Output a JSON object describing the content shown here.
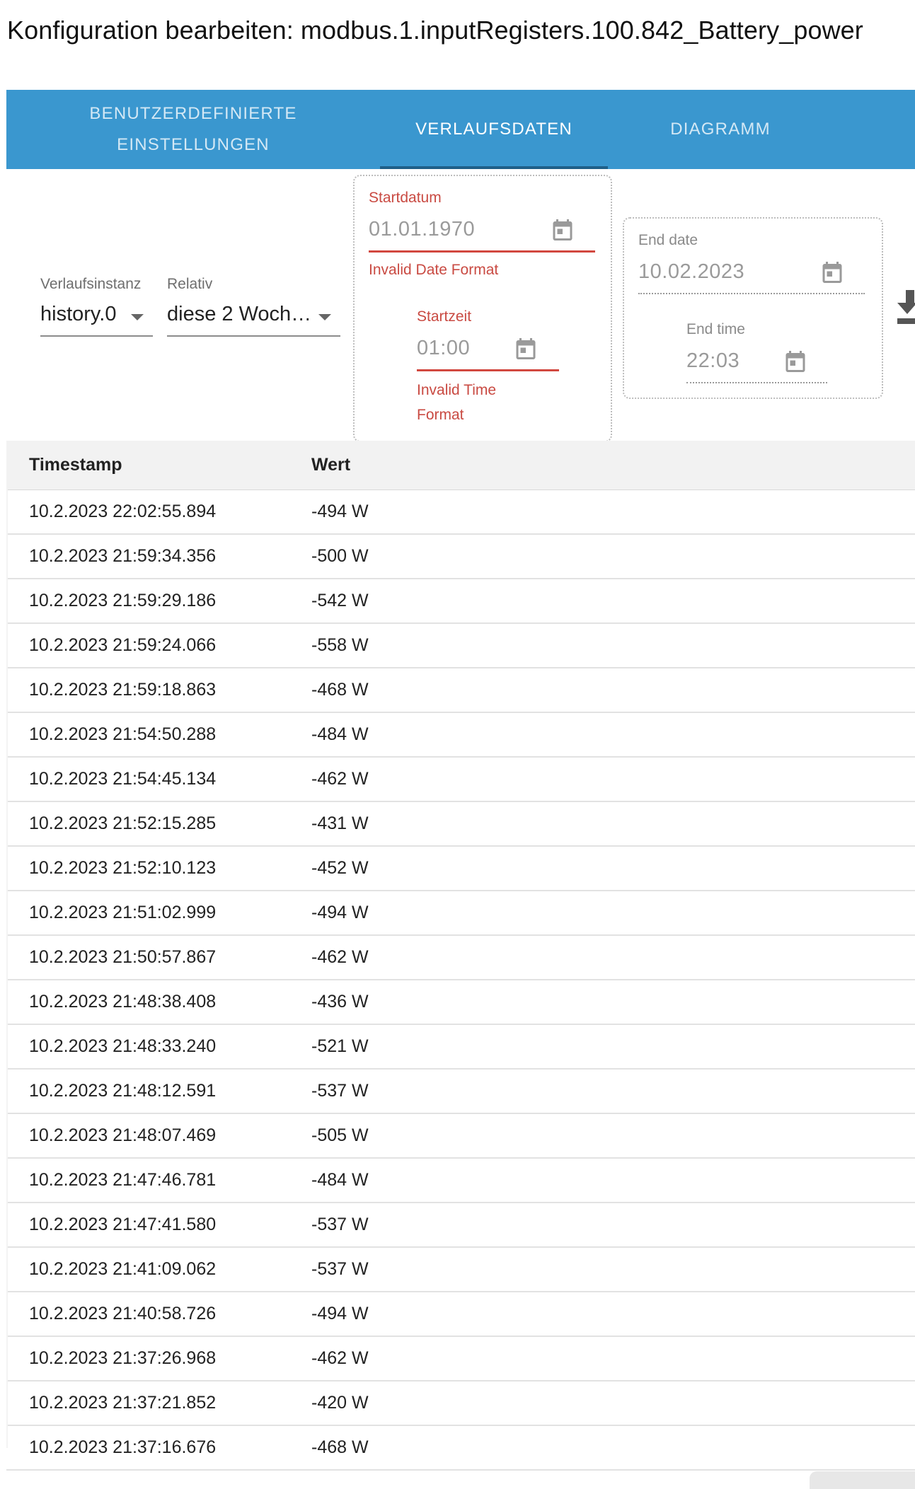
{
  "dialog": {
    "title": "Konfiguration bearbeiten: modbus.1.inputRegisters.100.842_Battery_power"
  },
  "tabs": [
    {
      "label": "BENUTZERDEFINIERTE EINSTELLUNGEN",
      "active": false
    },
    {
      "label": "VERLAUFSDATEN",
      "active": true
    },
    {
      "label": "DIAGRAMM",
      "active": false
    }
  ],
  "filters": {
    "history_instance": {
      "label": "Verlaufsinstanz",
      "value": "history.0"
    },
    "relative": {
      "label": "Relativ",
      "value": "diese 2 Woch…"
    },
    "start": {
      "date_label": "Startdatum",
      "date_value": "01.01.1970",
      "date_error": "Invalid Date Format",
      "time_label": "Startzeit",
      "time_value": "01:00",
      "time_error": "Invalid Time Format"
    },
    "end": {
      "date_label": "End date",
      "date_value": "10.02.2023",
      "time_label": "End time",
      "time_value": "22:03"
    }
  },
  "colors": {
    "tab_bar": "#3a97cf",
    "tab_indicator": "#1f5f88",
    "error": "#c94a42"
  },
  "table": {
    "columns": [
      "Timestamp",
      "Wert"
    ],
    "rows": [
      [
        "10.2.2023 22:02:55.894",
        "-494 W"
      ],
      [
        "10.2.2023 21:59:34.356",
        "-500 W"
      ],
      [
        "10.2.2023 21:59:29.186",
        "-542 W"
      ],
      [
        "10.2.2023 21:59:24.066",
        "-558 W"
      ],
      [
        "10.2.2023 21:59:18.863",
        "-468 W"
      ],
      [
        "10.2.2023 21:54:50.288",
        "-484 W"
      ],
      [
        "10.2.2023 21:54:45.134",
        "-462 W"
      ],
      [
        "10.2.2023 21:52:15.285",
        "-431 W"
      ],
      [
        "10.2.2023 21:52:10.123",
        "-452 W"
      ],
      [
        "10.2.2023 21:51:02.999",
        "-494 W"
      ],
      [
        "10.2.2023 21:50:57.867",
        "-462 W"
      ],
      [
        "10.2.2023 21:48:38.408",
        "-436 W"
      ],
      [
        "10.2.2023 21:48:33.240",
        "-521 W"
      ],
      [
        "10.2.2023 21:48:12.591",
        "-537 W"
      ],
      [
        "10.2.2023 21:48:07.469",
        "-505 W"
      ],
      [
        "10.2.2023 21:47:46.781",
        "-484 W"
      ],
      [
        "10.2.2023 21:47:41.580",
        "-537 W"
      ],
      [
        "10.2.2023 21:41:09.062",
        "-537 W"
      ],
      [
        "10.2.2023 21:40:58.726",
        "-494 W"
      ],
      [
        "10.2.2023 21:37:26.968",
        "-462 W"
      ],
      [
        "10.2.2023 21:37:21.852",
        "-420 W"
      ],
      [
        "10.2.2023 21:37:16.676",
        "-468 W"
      ]
    ]
  }
}
